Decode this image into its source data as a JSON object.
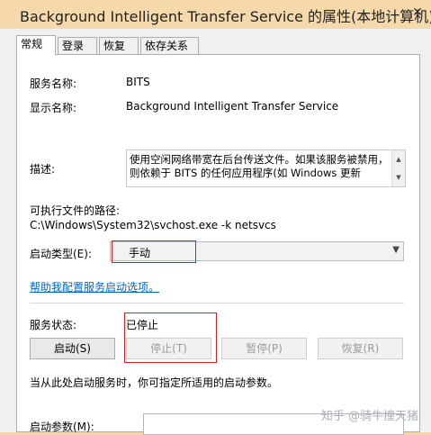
{
  "window": {
    "title": "Background Intelligent Transfer Service 的属性(本地计算机)",
    "close_icon": "close-icon"
  },
  "tabs": [
    {
      "label": "常规",
      "active": true
    },
    {
      "label": "登录",
      "active": false
    },
    {
      "label": "恢复",
      "active": false
    },
    {
      "label": "依存关系",
      "active": false
    }
  ],
  "general": {
    "service_name_label": "服务名称:",
    "service_name": "BITS",
    "display_name_label": "显示名称:",
    "display_name": "Background Intelligent Transfer Service",
    "description_label": "描述:",
    "description": "使用空闲网络带宽在后台传送文件。如果该服务被禁用，则依赖于 BITS 的任何应用程序(如 Windows 更新",
    "exe_path_label": "可执行文件的路径:",
    "exe_path": "C:\\Windows\\System32\\svchost.exe -k netsvcs",
    "startup_type_label": "启动类型(E):",
    "startup_type": "手动",
    "help_link": "帮助我配置服务启动选项。",
    "status_label": "服务状态:",
    "status": "已停止",
    "buttons": {
      "start": "启动(S)",
      "stop": "停止(T)",
      "pause": "暂停(P)",
      "resume": "恢复(R)"
    },
    "hint": "当从此处启动服务时，你可指定所适用的启动参数。",
    "params_label": "启动参数(M):",
    "params_value": ""
  },
  "watermark": "知乎 @骑牛撞天猪",
  "colors": {
    "highlight_box": "#d21f1f",
    "link": "#0066cc",
    "titlebar": "#f5d9ab"
  }
}
